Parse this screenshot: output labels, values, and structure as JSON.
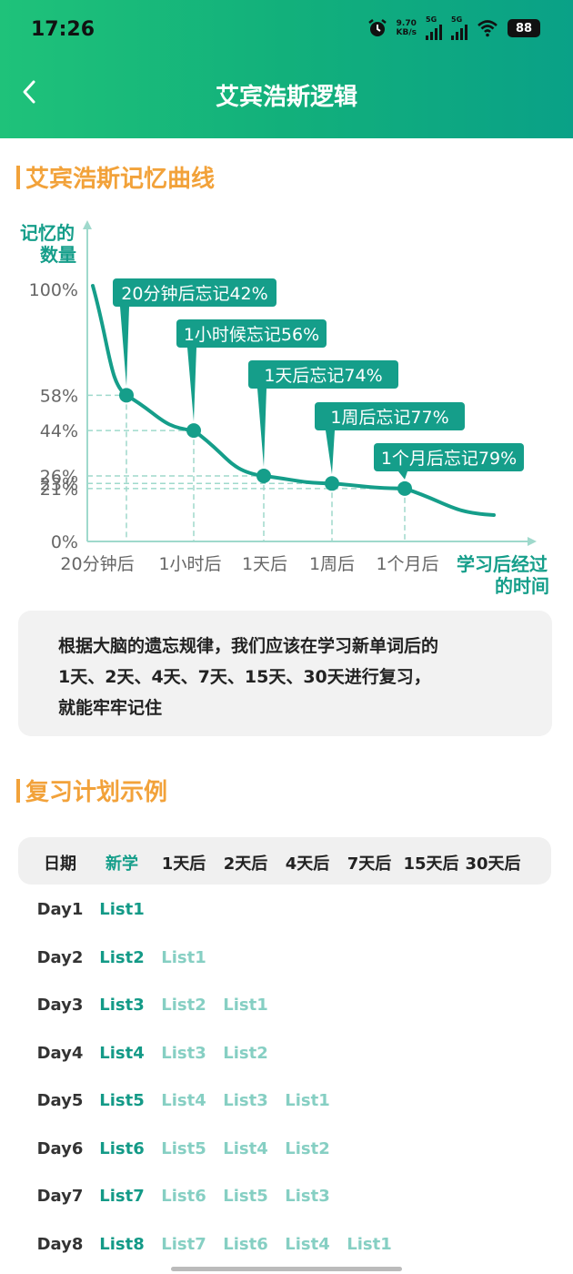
{
  "status_bar": {
    "time": "17:26",
    "net_speed_value": "9.70",
    "net_speed_unit": "KB/s",
    "signal_1": "5G",
    "signal_2": "5G",
    "battery": "88",
    "icons": [
      "alarm-icon",
      "signal-icon",
      "wifi-icon",
      "battery-icon"
    ]
  },
  "nav": {
    "back_icon": "chevron-left-icon",
    "title": "艾宾浩斯逻辑"
  },
  "curve_section": {
    "title": "艾宾浩斯记忆曲线"
  },
  "chart_data": {
    "type": "line",
    "ylabel": [
      "记忆的",
      "数量"
    ],
    "xlabel": [
      "学习后经过",
      "的时间"
    ],
    "y_ticks": [
      "100%",
      "58%",
      "44%",
      "26%",
      "23%",
      "21%",
      "0%"
    ],
    "categories": [
      "20分钟后",
      "1小时后",
      "1天后",
      "1周后",
      "1个月后"
    ],
    "values": [
      58,
      44,
      26,
      23,
      21
    ],
    "annotations": [
      "20分钟后忘记42%",
      "1小时候忘记56%",
      "1天后忘记74%",
      "1周后忘记77%",
      "1个月后忘记79%"
    ],
    "ylim": [
      0,
      100
    ],
    "line_color": "#159e8a",
    "label_bg": "#159e8a"
  },
  "info_box": {
    "lines": [
      "根据大脑的遗忘规律，我们应该在学习新单词后的",
      "1天、2天、4天、7天、15天、30天进行复习，",
      "就能牢牢记住"
    ]
  },
  "plan_section": {
    "title": "复习计划示例",
    "headers": [
      "日期",
      "新学",
      "1天后",
      "2天后",
      "4天后",
      "7天后",
      "15天后",
      "30天后"
    ],
    "rows": [
      {
        "day": "Day1",
        "new": "List1",
        "reviews": []
      },
      {
        "day": "Day2",
        "new": "List2",
        "reviews": [
          "List1"
        ]
      },
      {
        "day": "Day3",
        "new": "List3",
        "reviews": [
          "List2",
          "List1"
        ]
      },
      {
        "day": "Day4",
        "new": "List4",
        "reviews": [
          "List3",
          "List2"
        ]
      },
      {
        "day": "Day5",
        "new": "List5",
        "reviews": [
          "List4",
          "List3",
          "List1"
        ]
      },
      {
        "day": "Day6",
        "new": "List6",
        "reviews": [
          "List5",
          "List4",
          "List2"
        ]
      },
      {
        "day": "Day7",
        "new": "List7",
        "reviews": [
          "List6",
          "List5",
          "List3"
        ]
      },
      {
        "day": "Day8",
        "new": "List8",
        "reviews": [
          "List7",
          "List6",
          "List4",
          "List1"
        ]
      }
    ]
  },
  "colors": {
    "accent_orange": "#f2a23a",
    "teal": "#159e8a",
    "teal_light": "#86cfc3"
  }
}
